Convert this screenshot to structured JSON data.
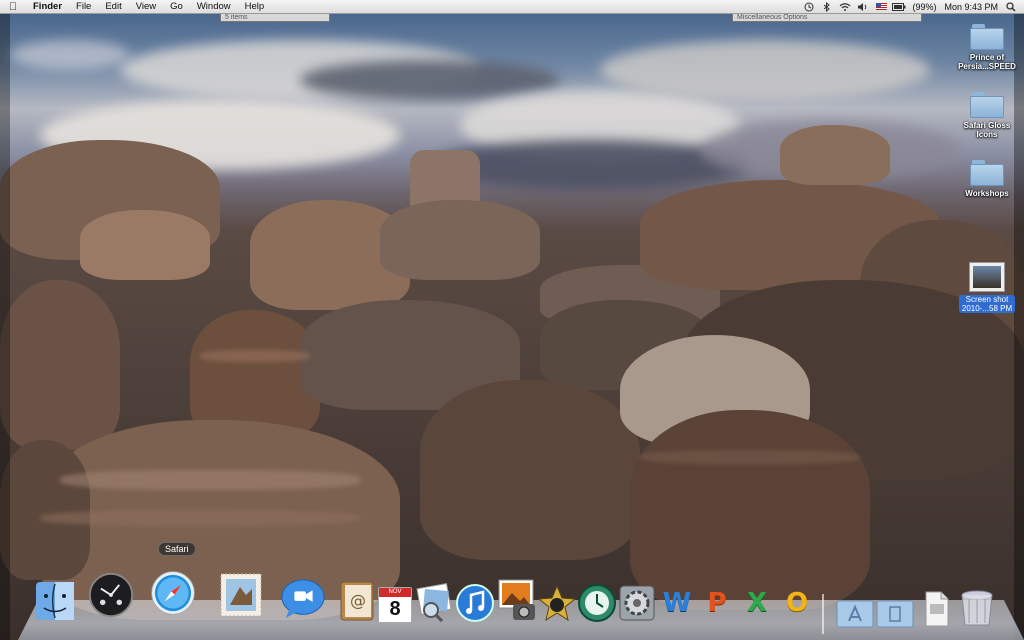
{
  "menubar": {
    "apple_icon": "apple-icon",
    "items": [
      {
        "label": "Finder",
        "bold": true
      },
      {
        "label": "File"
      },
      {
        "label": "Edit"
      },
      {
        "label": "View"
      },
      {
        "label": "Go"
      },
      {
        "label": "Window"
      },
      {
        "label": "Help"
      }
    ],
    "status": {
      "battery_percent": "(99%)",
      "clock": "Mon 9:43 PM"
    }
  },
  "background_windows": {
    "left_text": "5 items",
    "right_text": "Miscellaneous Options"
  },
  "desktop_icons": [
    {
      "label_line1": "Prince of",
      "label_line2": "Persia...SPEED",
      "icon": "folder-icon"
    },
    {
      "label_line1": "Safari Gloss",
      "label_line2": "Icons",
      "icon": "folder-icon"
    },
    {
      "label_line1": "Workshops",
      "label_line2": "",
      "icon": "folder-icon"
    },
    {
      "label_line1": "Screen shot",
      "label_line2": "2010-...58 PM",
      "icon": "screenshot-thumbnail-icon"
    }
  ],
  "dock": {
    "tooltip": "Safari",
    "calendar_day": "8",
    "calendar_month": "NOV",
    "apps": [
      "Finder",
      "Dashboard",
      "Safari",
      "Mail",
      "iChat",
      "Address Book",
      "iCal",
      "Preview",
      "iTunes",
      "iPhoto",
      "iMovie",
      "Time Machine",
      "System Preferences",
      "Word",
      "PowerPoint",
      "Excel",
      "Outlook"
    ],
    "stacks": [
      "Applications",
      "Documents",
      "Downloads",
      "Trash"
    ]
  },
  "colors": {
    "menubar_bg": "#e6e6e6",
    "selection_blue": "#2f6bd1",
    "word_blue": "#2b7fd8",
    "powerpoint_orange": "#e0541f",
    "excel_green": "#2da84a",
    "outlook_yellow": "#f2b418"
  }
}
